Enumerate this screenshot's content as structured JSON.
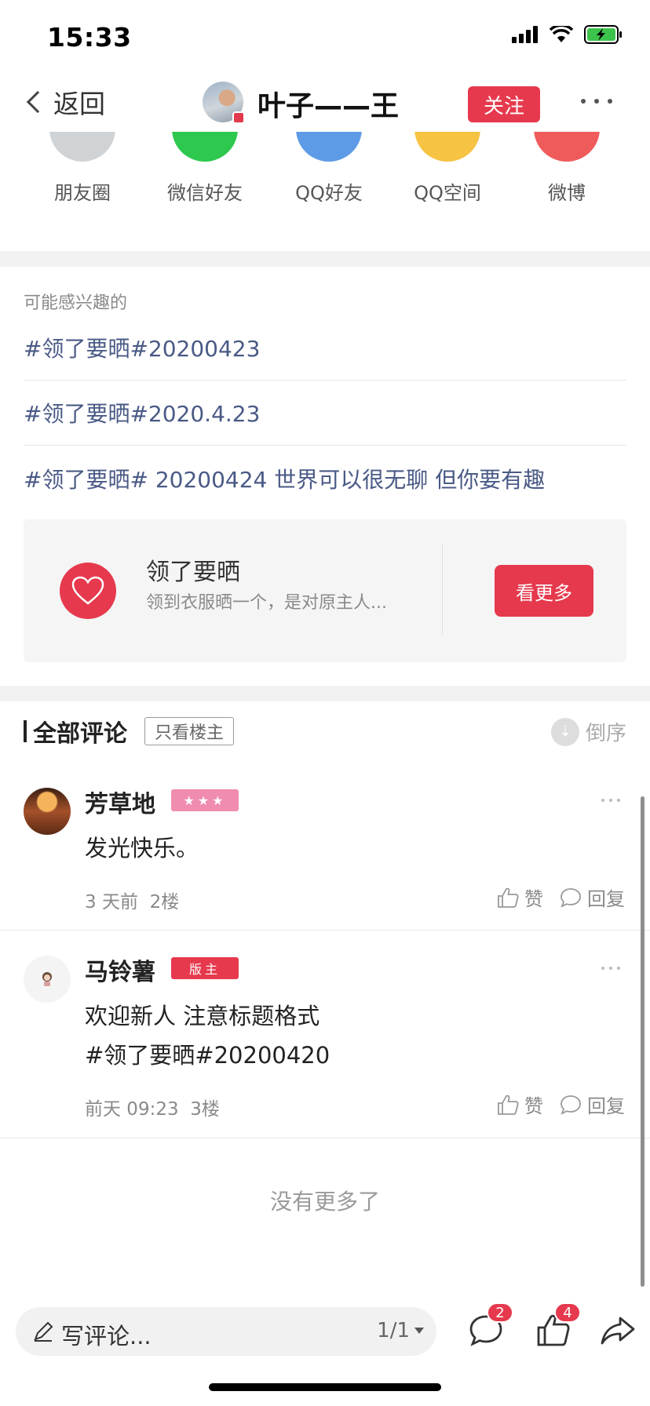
{
  "status": {
    "time": "15:33"
  },
  "nav": {
    "back_label": "返回",
    "title": "叶子——王",
    "follow_label": "关注"
  },
  "share": {
    "items": [
      {
        "label": "朋友圈",
        "color": "#cfd3d6"
      },
      {
        "label": "微信好友",
        "color": "#2dc84d"
      },
      {
        "label": "QQ好友",
        "color": "#5d9be6"
      },
      {
        "label": "QQ空间",
        "color": "#f6c343"
      },
      {
        "label": "微博",
        "color": "#ef5b5b"
      }
    ]
  },
  "interest": {
    "title": "可能感兴趣的",
    "links": [
      "#领了要晒#20200423",
      "#领了要晒#2020.4.23",
      "#领了要晒# 20200424 世界可以很无聊 但你要有趣"
    ]
  },
  "topic": {
    "name": "领了要晒",
    "description": "领到衣服晒一个，是对原主人...",
    "more_label": "看更多"
  },
  "comments_header": {
    "title": "全部评论",
    "filter_label": "只看楼主",
    "sort_label": "倒序"
  },
  "comments": [
    {
      "name": "芳草地",
      "badge": "★★★",
      "badge_color": "#f08cb0",
      "text_lines": [
        "发光快乐。"
      ],
      "time": "3 天前",
      "floor": "2楼",
      "like_label": "赞",
      "reply_label": "回复"
    },
    {
      "name": "马铃薯",
      "badge": "版主",
      "badge_color": "#e6394d",
      "text_lines": [
        "欢迎新人 注意标题格式",
        "#领了要晒#20200420"
      ],
      "time": "前天 09:23",
      "floor": "3楼",
      "like_label": "赞",
      "reply_label": "回复"
    }
  ],
  "footer": {
    "no_more": "没有更多了"
  },
  "bottom_bar": {
    "placeholder": "写评论...",
    "page": "1/1",
    "comment_count": "2",
    "like_count": "4"
  },
  "colors": {
    "accent": "#e6394d",
    "link": "#4a5a86"
  }
}
